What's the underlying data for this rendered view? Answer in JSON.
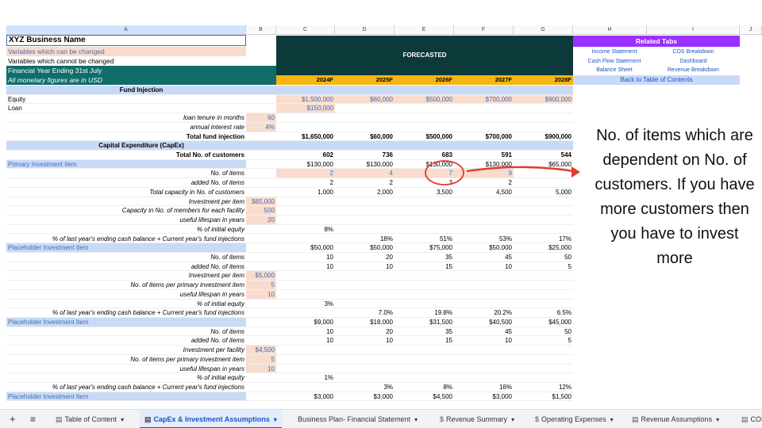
{
  "columns": [
    "A",
    "B",
    "C",
    "D",
    "E",
    "F",
    "G",
    "H",
    "I",
    "J"
  ],
  "header": {
    "biz_name": "XYZ Business Name",
    "can_change": "Variables which can be changed",
    "cannot_change": "Variables which cannot be changed",
    "fy": "Financial Year Ending 31st July",
    "monetary": "All monetary figures are in USD",
    "forecasted": "FORECASTED",
    "years": [
      "2024F",
      "2025F",
      "2026F",
      "2027F",
      "2028F"
    ]
  },
  "related": {
    "title": "Related Tabs",
    "links": [
      "Income Statement",
      "COS Breakdown",
      "Cash Flow Statement",
      "Dashboard",
      "Balance Sheet",
      "Revenue Breakdown"
    ],
    "back": "Back to Table of Contents"
  },
  "rows": [
    {
      "a": "Fund Injection",
      "b": "",
      "v": [
        "",
        "",
        "",
        "",
        ""
      ],
      "style": "sect"
    },
    {
      "a": "Equity",
      "b": "",
      "v": [
        "$1,500,000",
        "$60,000",
        "$500,000",
        "$700,000",
        "$900,000"
      ],
      "style": "equity"
    },
    {
      "a": "Loan",
      "b": "",
      "v": [
        "$150,000",
        "",
        "",
        "",
        ""
      ],
      "style": "loan"
    },
    {
      "a": "loan tenure in months",
      "b": "60",
      "v": [
        "",
        "",
        "",
        "",
        ""
      ],
      "style": "input"
    },
    {
      "a": "annual interest rate",
      "b": "4%",
      "v": [
        "",
        "",
        "",
        "",
        ""
      ],
      "style": "input"
    },
    {
      "a": "Total fund injection",
      "b": "",
      "v": [
        "$1,650,000",
        "$60,000",
        "$500,000",
        "$700,000",
        "$900,000"
      ],
      "style": "total"
    },
    {
      "a": "Capital Expenditure (CapEx)",
      "b": "",
      "v": [
        "",
        "",
        "",
        "",
        ""
      ],
      "style": "sect"
    },
    {
      "a": "Total No. of customers",
      "b": "",
      "v": [
        "602",
        "736",
        "683",
        "591",
        "544"
      ],
      "style": "bold"
    },
    {
      "a": "Primary Investment Item",
      "b": "",
      "v": [
        "$130,000",
        "$130,000",
        "$130,000",
        "$130,000",
        "$65,000"
      ],
      "style": "item"
    },
    {
      "a": "No. of items",
      "b": "",
      "v": [
        "2",
        "4",
        "7",
        "9",
        ""
      ],
      "style": "peachrow"
    },
    {
      "a": "added No. of items",
      "b": "",
      "v": [
        "2",
        "2",
        "3",
        "2",
        ""
      ],
      "style": "norm"
    },
    {
      "a": "Total capacity in No. of customers",
      "b": "",
      "v": [
        "1,000",
        "2,000",
        "3,500",
        "4,500",
        "5,000"
      ],
      "style": "norm"
    },
    {
      "a": "Investment per item",
      "b": "$65,000",
      "v": [
        "",
        "",
        "",
        "",
        ""
      ],
      "style": "input"
    },
    {
      "a": "Capacity in No. of members for each facility",
      "b": "500",
      "v": [
        "",
        "",
        "",
        "",
        ""
      ],
      "style": "input"
    },
    {
      "a": "useful lifespan in years",
      "b": "20",
      "v": [
        "",
        "",
        "",
        "",
        ""
      ],
      "style": "input"
    },
    {
      "a": "% of initial equity",
      "b": "",
      "v": [
        "8%",
        "",
        "",
        "",
        ""
      ],
      "style": "norm"
    },
    {
      "a": "% of last year's ending cash balance + Current year's fund injections",
      "b": "",
      "v": [
        "",
        "18%",
        "51%",
        "53%",
        "17%"
      ],
      "style": "norm"
    },
    {
      "a": "Placeholder Investment Item",
      "b": "",
      "v": [
        "$50,000",
        "$50,000",
        "$75,000",
        "$50,000",
        "$25,000"
      ],
      "style": "item"
    },
    {
      "a": "No. of items",
      "b": "",
      "v": [
        "10",
        "20",
        "35",
        "45",
        "50"
      ],
      "style": "norm"
    },
    {
      "a": "added No. of items",
      "b": "",
      "v": [
        "10",
        "10",
        "15",
        "10",
        "5"
      ],
      "style": "norm"
    },
    {
      "a": "Investment per item",
      "b": "$5,000",
      "v": [
        "",
        "",
        "",
        "",
        ""
      ],
      "style": "input"
    },
    {
      "a": "No. of items per primary investment item",
      "b": "5",
      "v": [
        "",
        "",
        "",
        "",
        ""
      ],
      "style": "input"
    },
    {
      "a": "useful lifespan in years",
      "b": "10",
      "v": [
        "",
        "",
        "",
        "",
        ""
      ],
      "style": "input"
    },
    {
      "a": "% of initial equity",
      "b": "",
      "v": [
        "3%",
        "",
        "",
        "",
        ""
      ],
      "style": "norm"
    },
    {
      "a": "% of last year's ending cash balance + Current year's fund injections",
      "b": "",
      "v": [
        "",
        "7.0%",
        "19.8%",
        "20.2%",
        "6.5%"
      ],
      "style": "norm"
    },
    {
      "a": "Placeholder Investment Item",
      "b": "",
      "v": [
        "$9,000",
        "$18,000",
        "$31,500",
        "$40,500",
        "$45,000"
      ],
      "style": "item"
    },
    {
      "a": "No. of items",
      "b": "",
      "v": [
        "10",
        "20",
        "35",
        "45",
        "50"
      ],
      "style": "norm"
    },
    {
      "a": "added No. of items",
      "b": "",
      "v": [
        "10",
        "10",
        "15",
        "10",
        "5"
      ],
      "style": "norm"
    },
    {
      "a": "Investment per facility",
      "b": "$4,500",
      "v": [
        "",
        "",
        "",
        "",
        ""
      ],
      "style": "input"
    },
    {
      "a": "No. of items per primary investment item",
      "b": "5",
      "v": [
        "",
        "",
        "",
        "",
        ""
      ],
      "style": "input"
    },
    {
      "a": "useful lifespan in years",
      "b": "10",
      "v": [
        "",
        "",
        "",
        "",
        ""
      ],
      "style": "input"
    },
    {
      "a": "% of initial equity",
      "b": "",
      "v": [
        "1%",
        "",
        "",
        "",
        ""
      ],
      "style": "norm"
    },
    {
      "a": "% of last year's ending cash balance + Current year's fund injections",
      "b": "",
      "v": [
        "",
        "3%",
        "8%",
        "16%",
        "12%"
      ],
      "style": "norm"
    },
    {
      "a": "Placeholder Investment Item",
      "b": "",
      "v": [
        "$3,000",
        "$3,000",
        "$4,500",
        "$3,000",
        "$1,500"
      ],
      "style": "item"
    }
  ],
  "annotation": "No. of items which are dependent on No. of customers. If you have more customers then you have to invest more",
  "tabs": {
    "add": "+",
    "menu": "≡",
    "items": [
      "Table of Content",
      "CapEx & Investment Assumptions",
      "Business Plan- Financial Statement",
      "Revenue Summary",
      "Operating Expenses",
      "Revenue Assumptions",
      "COS Su"
    ],
    "dropdown": "▾"
  },
  "colors": {
    "forecast_bg": "#0c3a3b",
    "year_bg": "#f6b512",
    "section_bg": "#c9daf8",
    "input_bg": "#f9dccd",
    "related_bg": "#9b30ff",
    "annotation": "#e23b2e"
  }
}
